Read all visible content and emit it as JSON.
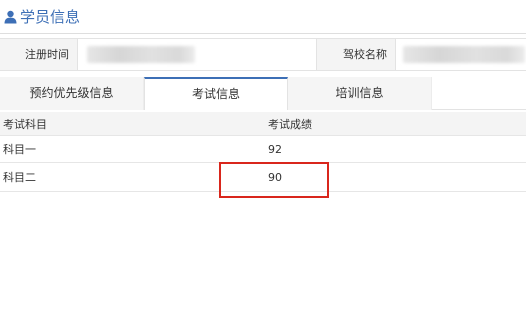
{
  "section": {
    "title": "学员信息",
    "icon": "user-icon",
    "accent_color": "#3d6fb6"
  },
  "info": {
    "registration_time_label": "注册时间",
    "school_name_label": "驾校名称"
  },
  "tabs": [
    {
      "label": "预约优先级信息",
      "active": false
    },
    {
      "label": "考试信息",
      "active": true
    },
    {
      "label": "培训信息",
      "active": false
    }
  ],
  "table": {
    "columns": [
      "考试科目",
      "考试成绩"
    ],
    "rows": [
      {
        "subject": "科目一",
        "score": "92"
      },
      {
        "subject": "科目二",
        "score": "90"
      }
    ]
  },
  "highlight_color": "#d9261c"
}
